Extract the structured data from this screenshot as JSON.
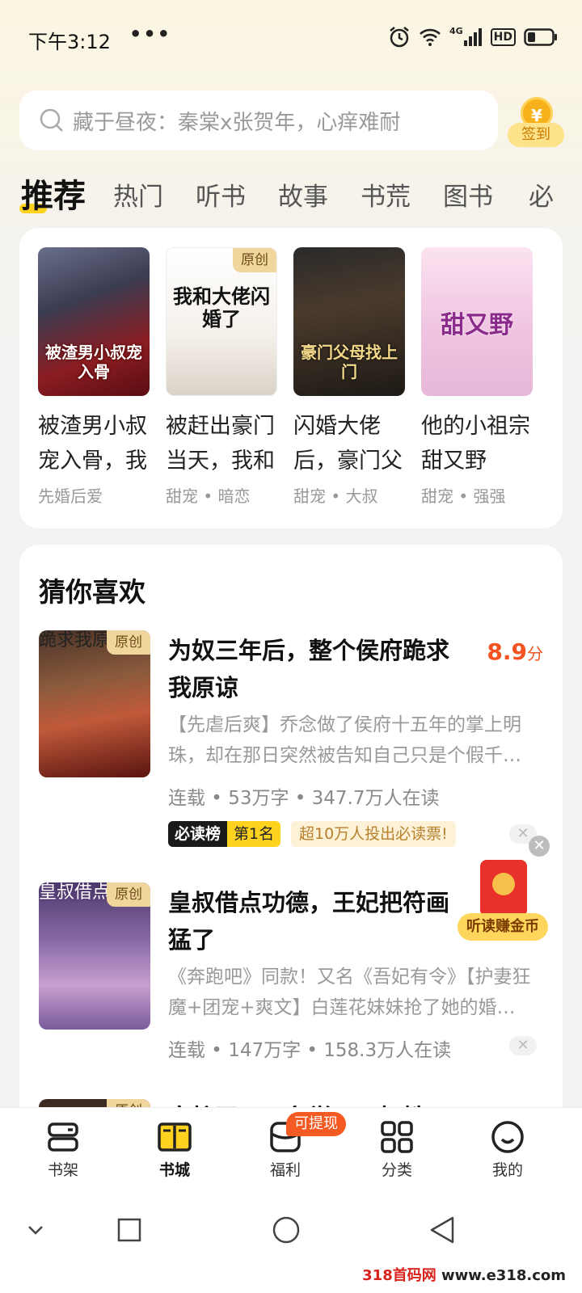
{
  "status_bar": {
    "time": "下午3:12",
    "more": "•••",
    "network": "4G",
    "hd": "HD"
  },
  "search": {
    "placeholder": "藏于昼夜：秦棠x张贺年，心痒难耐"
  },
  "signin": {
    "coin": "¥",
    "label": "签到"
  },
  "category_tabs": [
    {
      "label": "推荐",
      "active": true
    },
    {
      "label": "热门"
    },
    {
      "label": "听书"
    },
    {
      "label": "故事"
    },
    {
      "label": "书荒"
    },
    {
      "label": "图书"
    },
    {
      "label": "必"
    }
  ],
  "featured": [
    {
      "title": "被渣男小叔宠入骨，我",
      "tags": "先婚后爱",
      "cover_text": "被渣男小叔宠入骨",
      "original": ""
    },
    {
      "title": "被赶出豪门当天，我和",
      "tags": "甜宠 • 暗恋",
      "cover_text": "我和大佬闪婚了",
      "original": "原创"
    },
    {
      "title": "闪婚大佬后，豪门父",
      "tags": "甜宠 • 大叔",
      "cover_text": "豪门父母找上门",
      "original": ""
    },
    {
      "title": "他的小祖宗甜又野",
      "tags": "甜宠 • 强强",
      "cover_text": "甜又野",
      "original": ""
    }
  ],
  "guess": {
    "heading": "猜你喜欢",
    "items": [
      {
        "title": "为奴三年后，整个侯府跪求我原谅",
        "score": "8.9",
        "score_unit": "分",
        "desc": "【先虐后爽】乔念做了侯府十五年的掌上明珠，却在那日突然被告知自己只是个假千…",
        "meta": "连载 • 53万字 • 347.7万人在读",
        "rank_label": "必读榜",
        "rank_value": "第1名",
        "vote": "超10万人投出必读票!",
        "original": "原创",
        "cover_text": "跪求我原谅"
      },
      {
        "title": "皇叔借点功德，王妃把符画猛了",
        "desc": "《奔跑吧》同款！又名《吾妃有令》【护妻狂魔+团宠+爽文】白莲花妹妹抢了她的婚…",
        "meta": "连载 • 147万字 • 158.3万人在读",
        "original": "原创",
        "cover_text": "皇叔借点功德"
      },
      {
        "title": "富护王，三条学一三妇姓",
        "original": "原创"
      }
    ]
  },
  "float_widget": {
    "close": "✕",
    "label": "听读赚金币"
  },
  "bottom_nav": [
    {
      "label": "书架",
      "icon": "bookshelf-icon"
    },
    {
      "label": "书城",
      "icon": "bookstore-icon",
      "active": true
    },
    {
      "label": "福利",
      "icon": "welfare-icon"
    },
    {
      "label": "分类",
      "icon": "category-icon"
    },
    {
      "label": "我的",
      "icon": "profile-icon"
    }
  ],
  "withdraw_badge": "可提现",
  "watermark": {
    "part1": "318首码网",
    "part2": "www.e318.com"
  },
  "colors": {
    "accent": "#ffd21f",
    "score": "#f25321",
    "badge": "#f45a22"
  }
}
